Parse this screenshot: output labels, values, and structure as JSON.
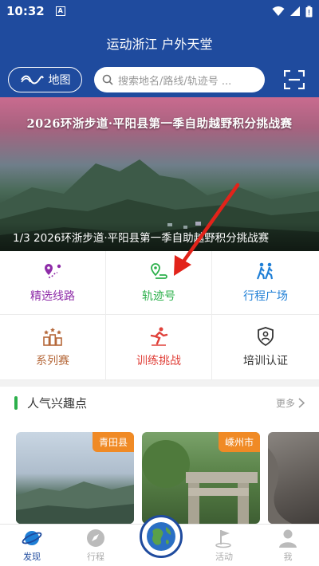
{
  "status_bar": {
    "time": "10:32",
    "note_icon": "A"
  },
  "header": {
    "title": "运动浙江 户外天堂",
    "map_button": "地图",
    "search_placeholder": "搜索地名/路线/轨迹号 ..."
  },
  "banner": {
    "headline": "2026环浙步道·平阳县第一季自助越野积分挑战赛",
    "caption": "1/3 2026环浙步道·平阳县第一季自助越野积分挑战赛"
  },
  "menu": [
    {
      "label": "精选线路",
      "icon": "route-icon",
      "color": "#8e2ca8"
    },
    {
      "label": "轨迹号",
      "icon": "track-icon",
      "color": "#2cb04b"
    },
    {
      "label": "行程广场",
      "icon": "hikers-icon",
      "color": "#1f7fd6"
    },
    {
      "label": "系列赛",
      "icon": "podium-icon",
      "color": "#b5683a"
    },
    {
      "label": "训练挑战",
      "icon": "runner-icon",
      "color": "#e0413a"
    },
    {
      "label": "培训认证",
      "icon": "badge-icon",
      "color": "#333333"
    }
  ],
  "section": {
    "title": "人气兴趣点",
    "more": "更多"
  },
  "cards": [
    {
      "tag": "青田县"
    },
    {
      "tag": "嵊州市"
    }
  ],
  "tabs": [
    {
      "label": "发现",
      "active": true
    },
    {
      "label": "行程",
      "active": false
    },
    {
      "label": "活动",
      "active": false
    },
    {
      "label": "我",
      "active": false
    }
  ],
  "colors": {
    "primary": "#1f4b9e",
    "accent_green": "#2cb04b",
    "tag_orange": "#f08a25",
    "arrow_red": "#e2231a"
  }
}
